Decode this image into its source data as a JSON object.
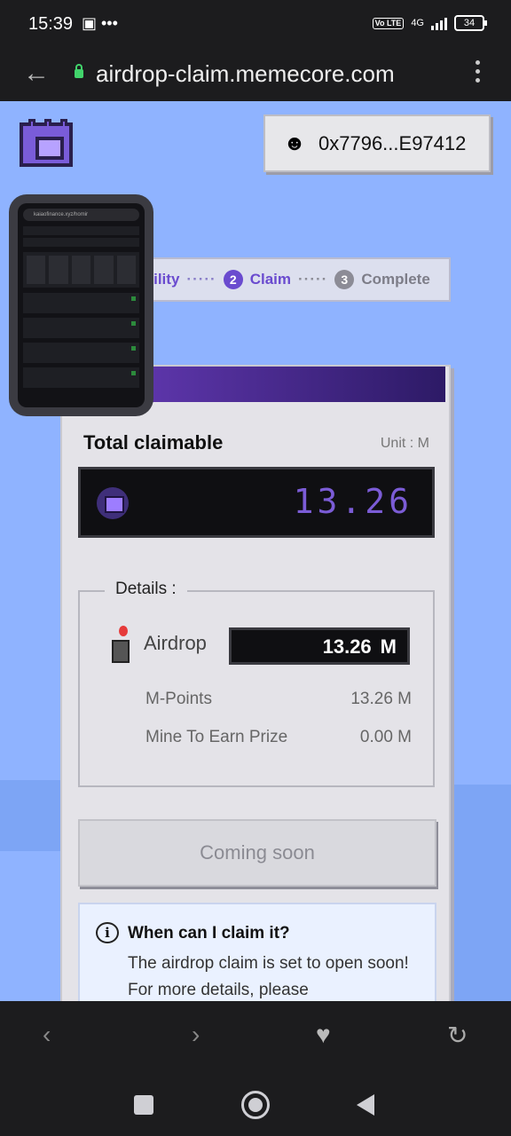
{
  "status_bar": {
    "time": "15:39",
    "left_icons": "▣ •••",
    "volte": "Vo LTE",
    "network": "4G",
    "battery": "34"
  },
  "browser": {
    "url": "airdrop-claim.memecore.com"
  },
  "header": {
    "wallet_address": "0x7796...E97412"
  },
  "steps": {
    "items": [
      {
        "number": "",
        "label": "ibility"
      },
      {
        "number": "2",
        "label": "Claim"
      },
      {
        "number": "3",
        "label": "Complete"
      }
    ],
    "separator": "·····"
  },
  "thumbnail": {
    "url_text": "kaiaofinance.xyz/homir"
  },
  "claim": {
    "title": "Total claimable",
    "unit": "Unit : M",
    "total_value": "13.26",
    "details_legend": "Details :",
    "airdrop_label": "Airdrop",
    "airdrop_value": "13.26",
    "airdrop_unit": "M",
    "rows": [
      {
        "label": "M-Points",
        "value": "13.26 M"
      },
      {
        "label": "Mine To Earn Prize",
        "value": "0.00 M"
      }
    ],
    "button_label": "Coming soon",
    "info_title": "When can I claim it?",
    "info_body": "The airdrop claim is set to open soon! For more details, please"
  },
  "toolbar": {
    "back": "‹",
    "forward": "›",
    "favorite": "♥",
    "reload": "↻"
  },
  "icons": {
    "wallet_avatar": "pixel-avatar-icon",
    "info": "info-bubble-icon",
    "airdrop": "balloon-icon"
  },
  "colors": {
    "accent": "#6a4bcf",
    "page_bg": "#8fb3ff",
    "display_digits": "#7b5cd6"
  }
}
